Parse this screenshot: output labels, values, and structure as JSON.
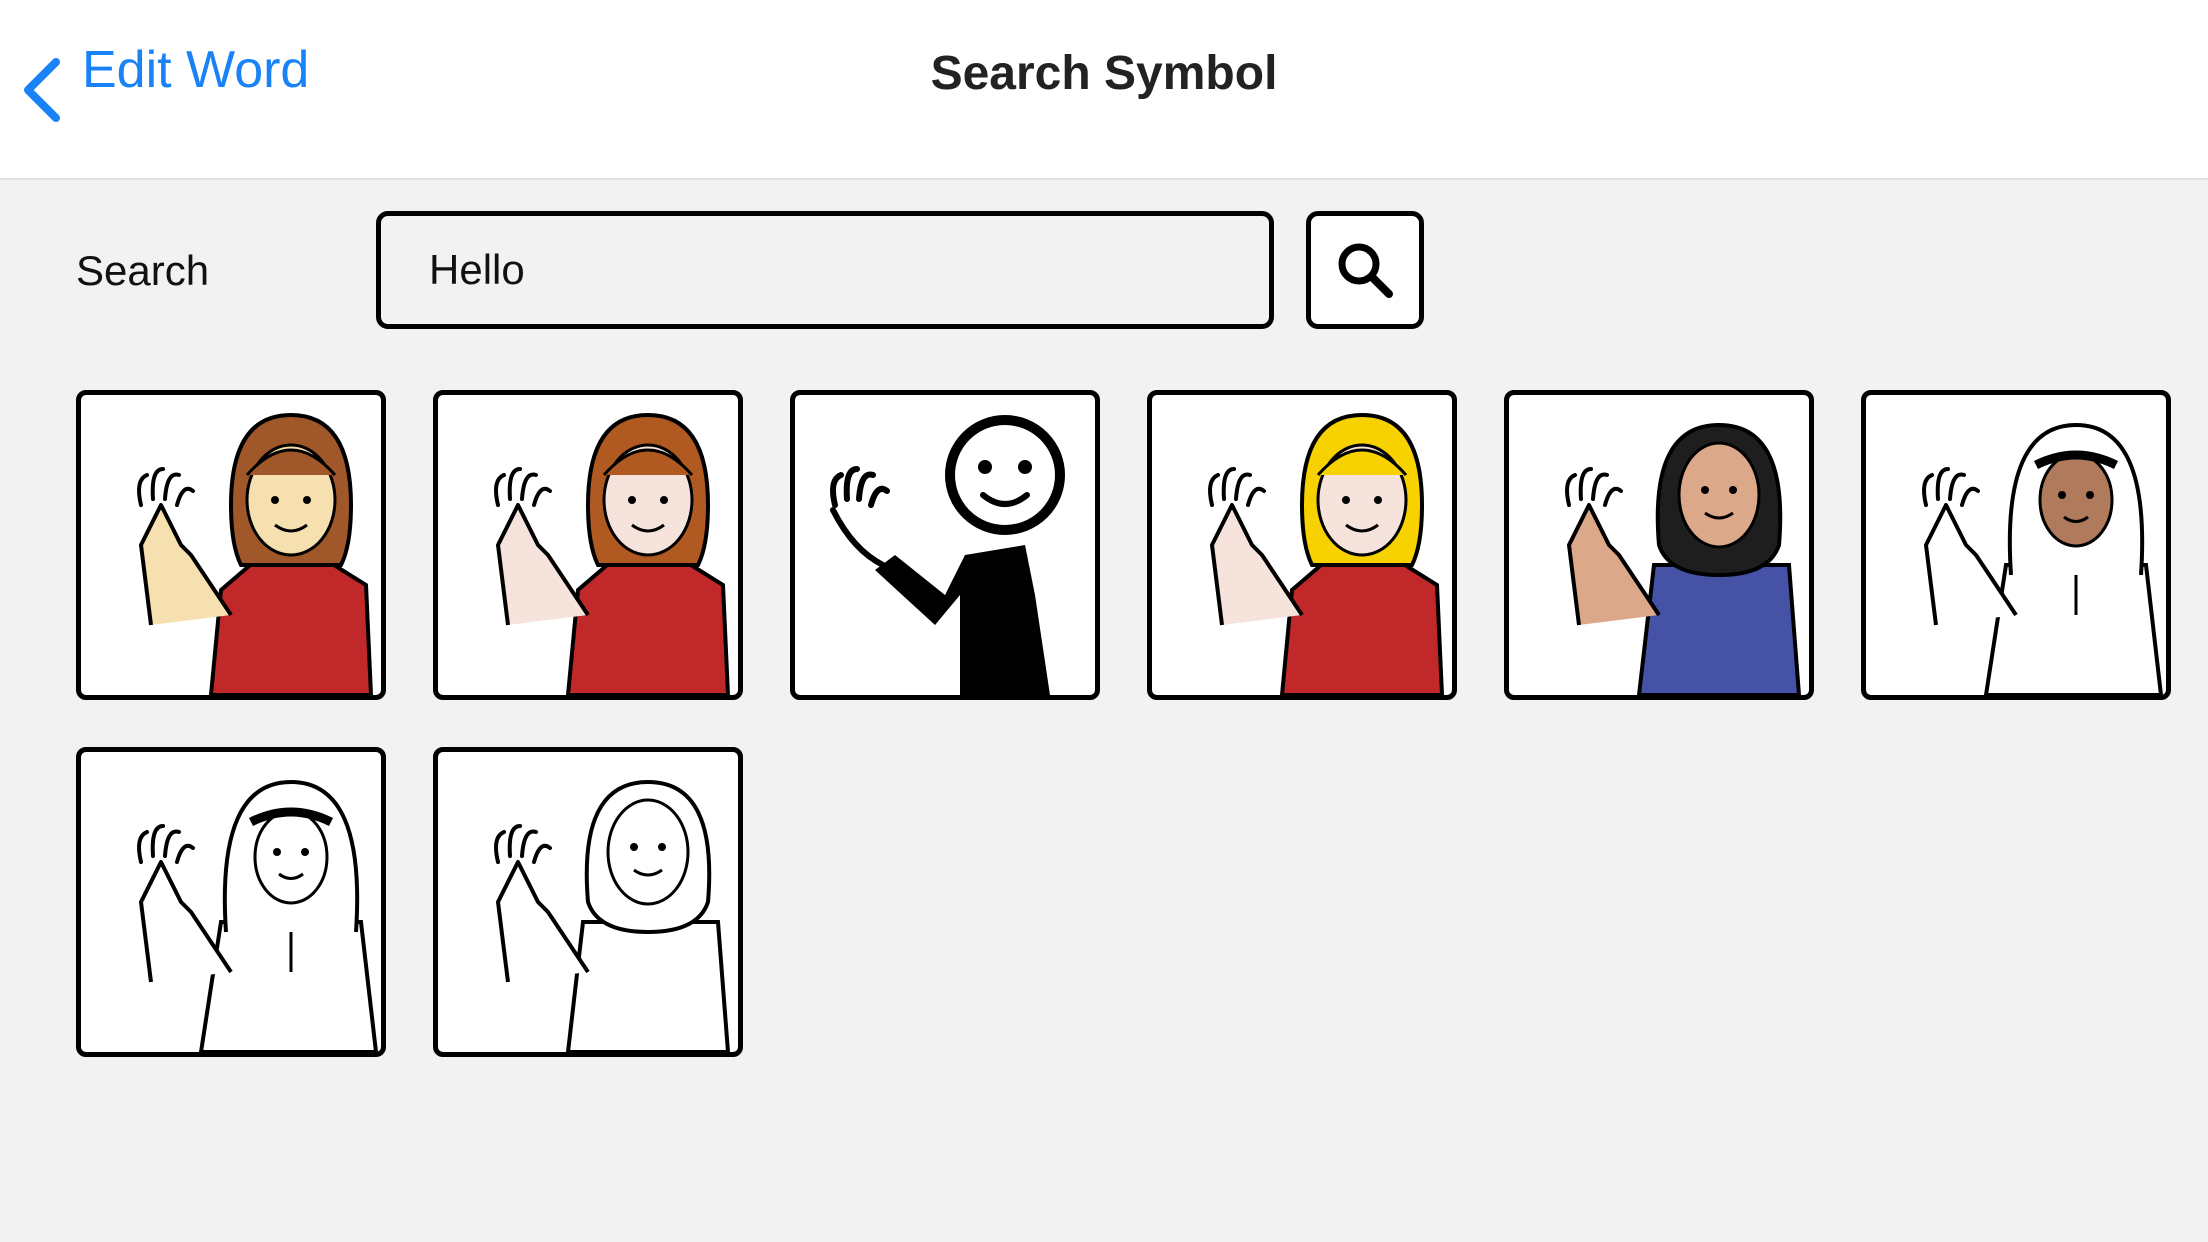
{
  "navbar": {
    "back_label": "Edit Word",
    "title": "Search Symbol"
  },
  "search": {
    "label": "Search",
    "value": "Hello",
    "button_icon": "search-icon"
  },
  "results": [
    {
      "symbol": "man-raising-hand-symbol",
      "skin": "#f6e0b0",
      "hair": "#a0582a",
      "shirt": "#c0282a"
    },
    {
      "symbol": "girl-waving-symbol",
      "skin": "#f5e3dc",
      "hair": "#b05a22",
      "shirt": "#c0282a"
    },
    {
      "symbol": "stick-figure-waving-symbol",
      "skin": "#ffffff",
      "hair": "#000000",
      "shirt": "#000000"
    },
    {
      "symbol": "blonde-girl-waving-symbol",
      "skin": "#f5e3dc",
      "hair": "#f7d100",
      "shirt": "#c0282a"
    },
    {
      "symbol": "woman-hijab-waving-symbol",
      "skin": "#dca88a",
      "hair": "#1e1e1e",
      "shirt": "#4652a6"
    },
    {
      "symbol": "man-ghutra-waving-symbol",
      "skin": "#b07a5c",
      "hair": "#ffffff",
      "shirt": "#ffffff"
    },
    {
      "symbol": "man-ghutra-outline-waving-symbol",
      "skin": "#ffffff",
      "hair": "#ffffff",
      "shirt": "#ffffff"
    },
    {
      "symbol": "woman-hijab-outline-waving-symbol",
      "skin": "#ffffff",
      "hair": "#ffffff",
      "shirt": "#ffffff"
    }
  ],
  "colors": {
    "accent": "#1a82f7",
    "background": "#f2f2f2",
    "border": "#000000"
  }
}
